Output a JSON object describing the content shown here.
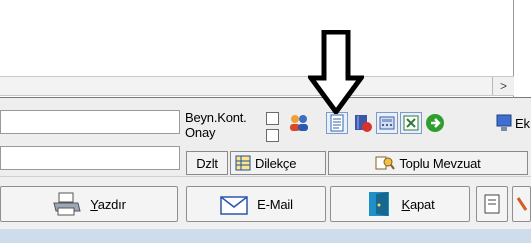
{
  "editor": {
    "scroll_arrow": ">"
  },
  "labels": {
    "beyn_kont": "Beyn.Kont.",
    "onay": "Onay",
    "ek_partial": "Ek"
  },
  "buttons": {
    "dzlt": "Dzlt",
    "dilekce": "Dilekçe",
    "toplu_mevzuat": "Toplu Mevzuat",
    "yazdir_first": "Y",
    "yazdir_rest": "azdır",
    "email": "E-Mail",
    "kapat_first": "K",
    "kapat_rest": "apat"
  },
  "icons": [
    "users-icon",
    "document-icon",
    "book-badge-icon",
    "calculator-icon",
    "excel-icon",
    "go-arrow-icon",
    "computer-icon",
    "printer-icon",
    "envelope-icon",
    "door-exit-icon",
    "note-icon",
    "tool-icon"
  ],
  "colors": {
    "band": "#eeeeee",
    "strip": "#cfdcec",
    "go_green": "#2f9e2f"
  }
}
